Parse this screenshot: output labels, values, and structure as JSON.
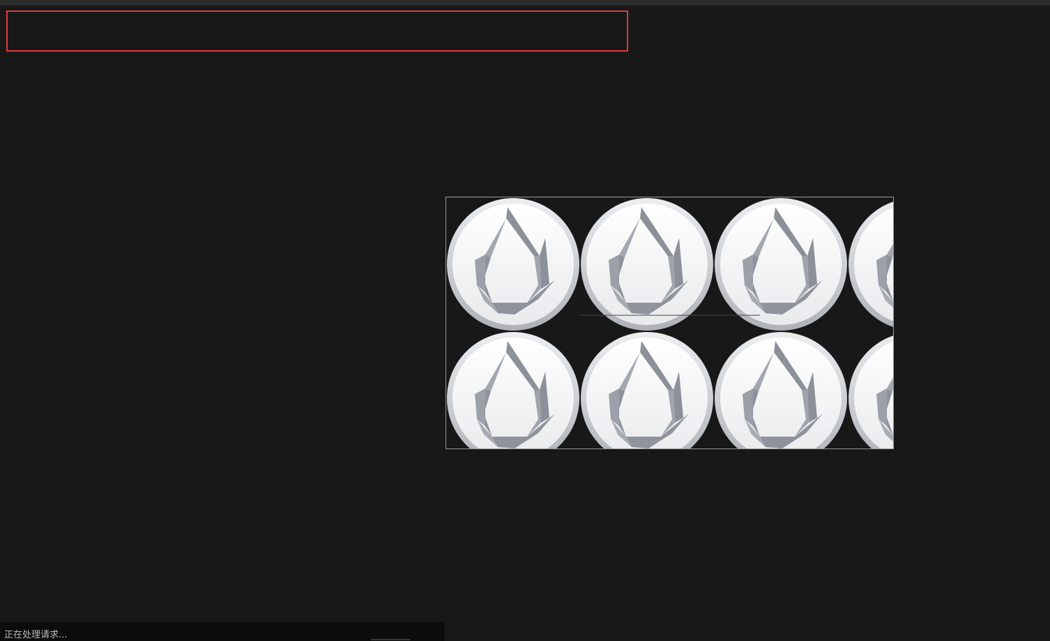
{
  "status_bar": {
    "message": "正在处理请求..."
  },
  "image_tile": {
    "icon": "ethereum-flame-coin-icon",
    "rows": 2,
    "columns": 4
  },
  "colors": {
    "background": "#181818",
    "highlight_border": "#e03a3a",
    "coin_face": "#f4f4f5",
    "coin_rim": "#c7cacf",
    "emblem": "#9ea3ab"
  }
}
